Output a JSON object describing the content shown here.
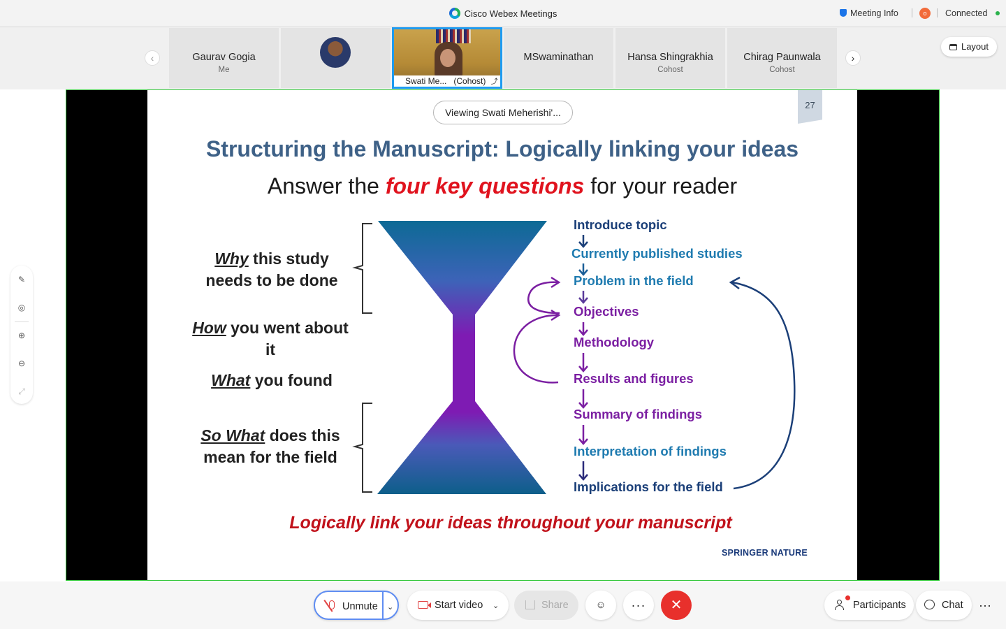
{
  "titlebar": {
    "app_title": "Cisco Webex Meetings",
    "meeting_info": "Meeting Info",
    "record_icon": "record-icon",
    "status": "Connected",
    "status_color": "#2bb24c"
  },
  "participants_strip": {
    "tiles": [
      {
        "name": "Gaurav Gogia",
        "role": "Me"
      },
      {
        "name": "",
        "role": ""
      },
      {
        "name": "Swati Me...",
        "role": "(Cohost)"
      },
      {
        "name": "MSwaminathan",
        "role": ""
      },
      {
        "name": "Hansa Shingrakhia",
        "role": "Cohost"
      },
      {
        "name": "Chirag Paunwala",
        "role": "Cohost"
      }
    ],
    "layout_label": "Layout",
    "active_border_color": "#1e9bf0"
  },
  "share": {
    "viewing_label": "Viewing Swati Meherishi'...",
    "border_color": "#35c83c"
  },
  "slide": {
    "page_number": "27",
    "title": "Structuring the Manuscript: Logically linking your ideas",
    "subtitle_pre": "Answer the ",
    "subtitle_accent": "four key questions",
    "subtitle_post": " for your reader",
    "questions": [
      {
        "emph": "Why",
        "rest1": " this study",
        "rest2": "needs to be done"
      },
      {
        "emph": "How",
        "rest1": " you went about",
        "rest2": "it"
      },
      {
        "emph": "What",
        "rest1": " you found",
        "rest2": ""
      },
      {
        "emph": "So What",
        "rest1": " does this",
        "rest2": "mean for the field"
      }
    ],
    "steps": [
      "Introduce topic",
      "Currently published studies",
      "Problem in the field",
      "Objectives",
      "Methodology",
      "Results and figures",
      "Summary of findings",
      "Interpretation of findings",
      "Implications for the field"
    ],
    "footer": "Logically link your ideas throughout your manuscript",
    "brand": "SPRINGER NATURE",
    "colors": {
      "title": "#3e6187",
      "accent": "#e0131e",
      "navy": "#1b3f78",
      "teal": "#1f7bb0",
      "purple": "#7b1fa2"
    }
  },
  "tools": [
    "annotate-icon",
    "pointer-icon",
    "zoom-in-icon",
    "zoom-out-icon",
    "fit-icon"
  ],
  "controls": {
    "unmute": "Unmute",
    "start_video": "Start video",
    "share": "Share",
    "more": "···",
    "end": "✕",
    "participants": "Participants",
    "chat": "Chat",
    "overflow": "···",
    "end_color": "#e8302c"
  }
}
